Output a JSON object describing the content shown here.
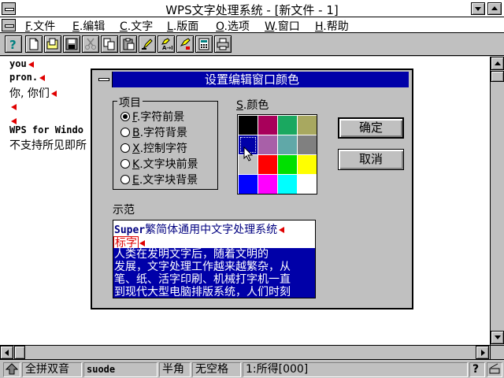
{
  "window": {
    "title": "WPS文字处理系统 - [新文件 - 1]"
  },
  "menu": [
    {
      "mn": "F",
      "label": ".文件"
    },
    {
      "mn": "E",
      "label": ".编辑"
    },
    {
      "mn": "C",
      "label": ".文字"
    },
    {
      "mn": "L",
      "label": ".版面"
    },
    {
      "mn": "O",
      "label": ".选项"
    },
    {
      "mn": "W",
      "label": ".窗口"
    },
    {
      "mn": "H",
      "label": ".帮助"
    }
  ],
  "document": {
    "lines": [
      "you",
      "pron.",
      "你, 你们",
      "",
      "",
      "WPS for Windo",
      "不支持所见即所"
    ]
  },
  "dialog": {
    "title": "设置编辑窗口颜色",
    "items_group_label": "项目",
    "items": [
      {
        "mn": "F",
        "label": ".字符前景",
        "selected": true
      },
      {
        "mn": "B",
        "label": ".字符背景",
        "selected": false
      },
      {
        "mn": "X",
        "label": ".控制字符",
        "selected": false
      },
      {
        "mn": "K",
        "label": ".文字块前景",
        "selected": false
      },
      {
        "mn": "E",
        "label": ".文字块背景",
        "selected": false
      }
    ],
    "color_label_mn": "S",
    "color_label": ".颜色",
    "palette": [
      "#000000",
      "#a8005a",
      "#1aa860",
      "#a8a860",
      "#0000a8",
      "#a860a8",
      "#60a8a8",
      "#808080",
      "#c0c0c0",
      "#ff0000",
      "#00e000",
      "#ffff00",
      "#0000ff",
      "#ff00ff",
      "#00ffff",
      "#ffffff"
    ],
    "selected_color_index": 4,
    "ok_label": "确定",
    "cancel_label": "取消",
    "sample_label": "示范",
    "sample": {
      "line1_latin": "Super",
      "line1_rest": "繁简体通用中文字处理系统",
      "line2": "标字",
      "block": [
        "    人类在发明文字后，随着文明的",
        "发展，文字处理工作越来越繁杂，从",
        "笔、纸、活字印刷、机械打字机一直",
        "到现代大型电脑排版系统，人们时刻"
      ]
    }
  },
  "statusbar": {
    "ime": "全拼双音",
    "input_code": "suode",
    "width_mode": "半角",
    "spacing": "无空格",
    "candidate": "1:所得[000]"
  }
}
